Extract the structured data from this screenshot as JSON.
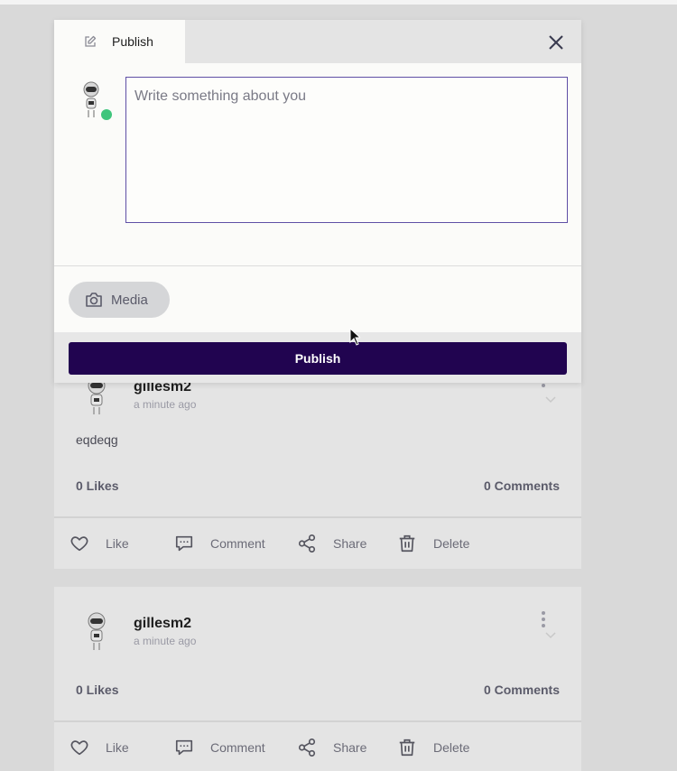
{
  "modal": {
    "tab_label": "Publish",
    "compose_placeholder": "Write something about you",
    "media_label": "Media",
    "publish_label": "Publish"
  },
  "posts": [
    {
      "username": "gillesm2",
      "time": "a minute ago",
      "text": "eqdeqg",
      "likes": "0 Likes",
      "comments": "0 Comments",
      "actions": {
        "like": "Like",
        "comment": "Comment",
        "share": "Share",
        "delete": "Delete"
      }
    },
    {
      "username": "gillesm2",
      "time": "a minute ago",
      "text": "",
      "likes": "0 Likes",
      "comments": "0 Comments",
      "actions": {
        "like": "Like",
        "comment": "Comment",
        "share": "Share",
        "delete": "Delete"
      }
    }
  ],
  "colors": {
    "accent": "#210450",
    "online": "#3fc57c",
    "compose_border": "#5f4fa6"
  },
  "icons": {
    "tab": "edit-icon",
    "close": "close-icon",
    "media": "camera-icon",
    "like": "heart-icon",
    "comment": "comment-icon",
    "share": "share-icon",
    "delete": "trash-icon",
    "menu": "more-vertical-icon"
  }
}
